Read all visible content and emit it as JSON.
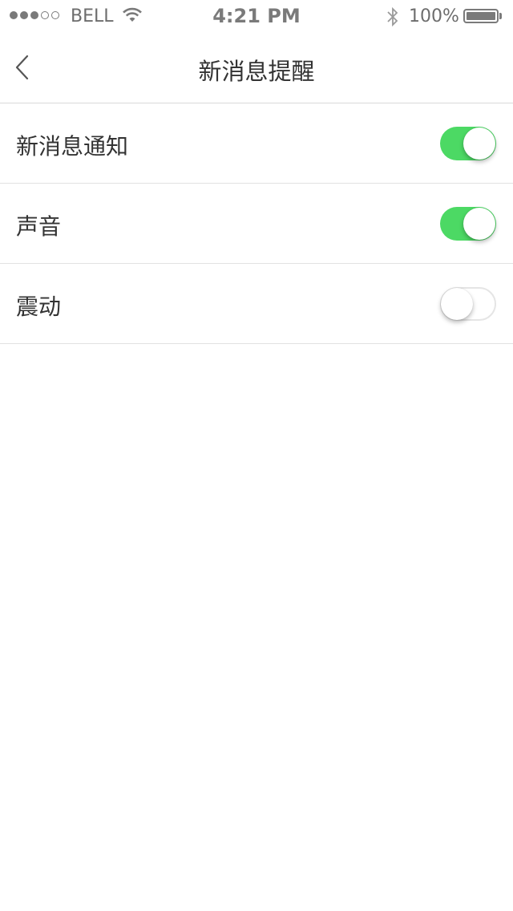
{
  "status_bar": {
    "carrier": "BELL",
    "time": "4:21 PM",
    "battery_percent": "100%",
    "battery_level": 1.0,
    "signal_strength": 3,
    "signal_max": 5
  },
  "nav": {
    "title": "新消息提醒",
    "back_icon": "chevron-left-icon"
  },
  "settings": [
    {
      "label": "新消息通知",
      "enabled": true
    },
    {
      "label": "声音",
      "enabled": true
    },
    {
      "label": "震动",
      "enabled": false
    }
  ],
  "colors": {
    "toggle_on": "#4cd964",
    "toggle_off_border": "#e5e5e5"
  }
}
